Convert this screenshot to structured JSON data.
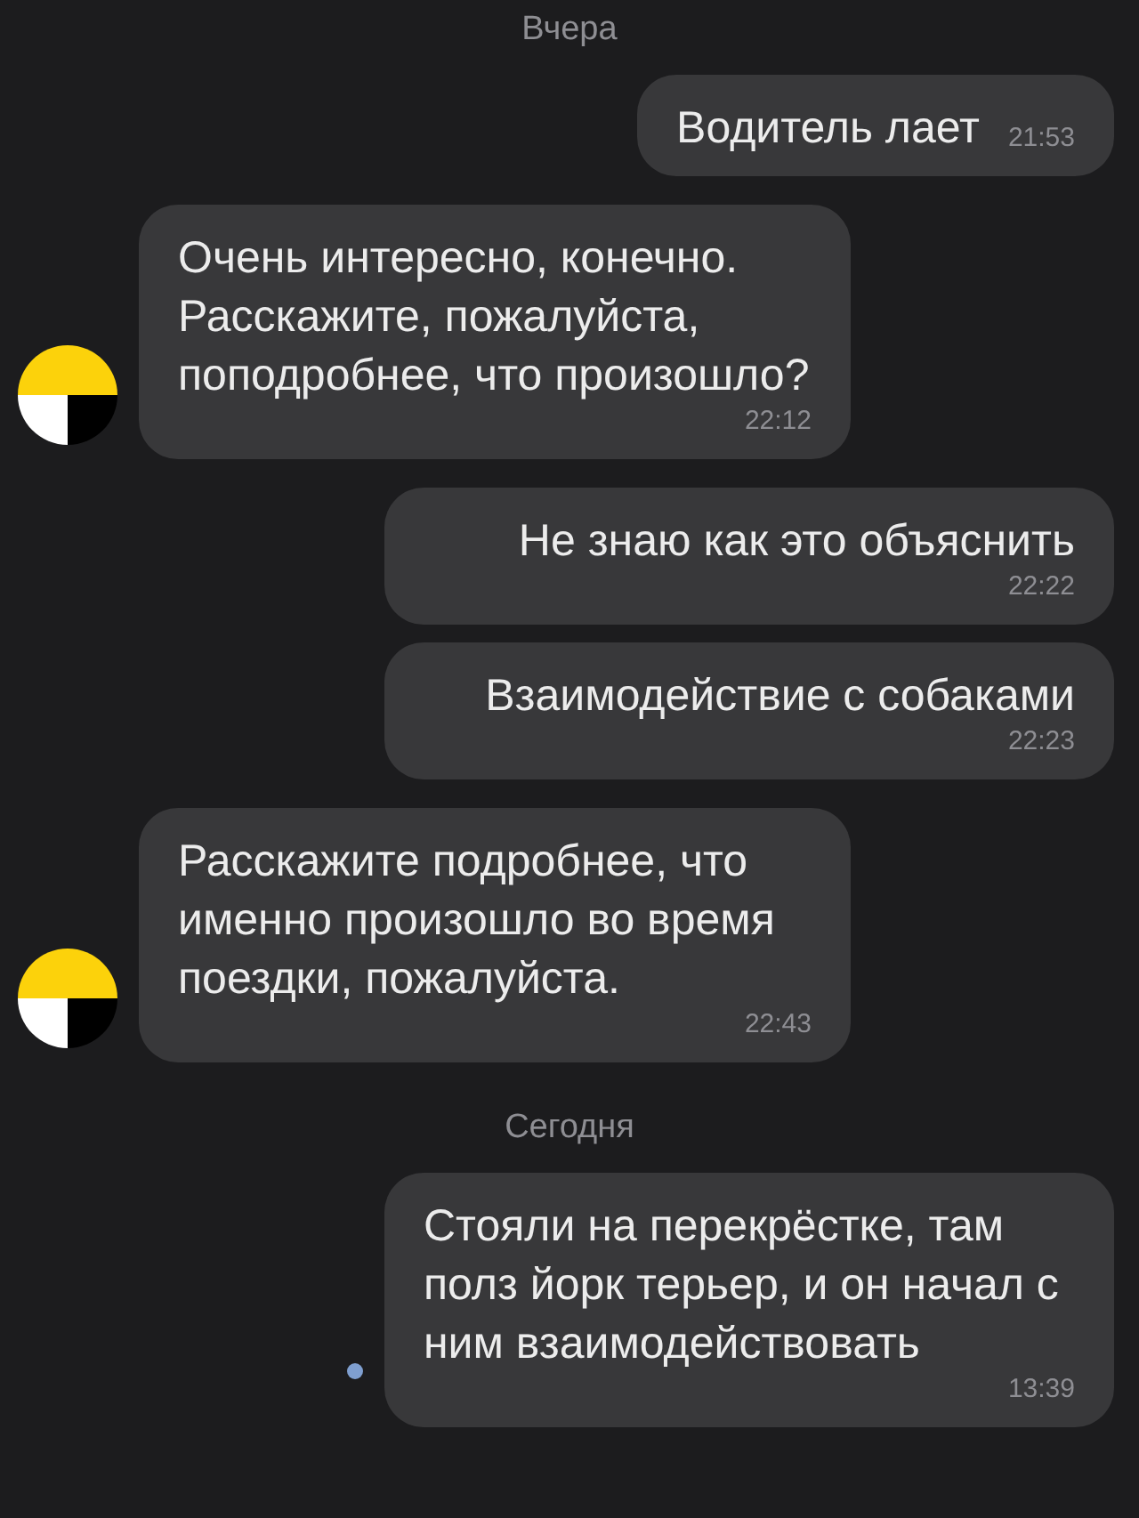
{
  "items": [
    {
      "kind": "date",
      "label": "Вчера"
    },
    {
      "kind": "message",
      "outgoing": true,
      "text": "Водитель лает",
      "time": "21:53",
      "pending": false
    },
    {
      "kind": "message",
      "outgoing": false,
      "text": "Очень интересно, конечно. Расскажите, пожалуйста, поподробнее, что произошло?",
      "time": "22:12",
      "pending": false
    },
    {
      "kind": "message",
      "outgoing": true,
      "text": "Не знаю как это объяснить",
      "time": "22:22",
      "pending": false
    },
    {
      "kind": "message",
      "outgoing": true,
      "text": "Взаимодействие с собаками",
      "time": "22:23",
      "pending": false
    },
    {
      "kind": "message",
      "outgoing": false,
      "text": "Расскажите подробнее, что именно произошло во время поездки, пожалуйста.",
      "time": "22:43",
      "pending": false
    },
    {
      "kind": "date",
      "label": "Сегодня"
    },
    {
      "kind": "message",
      "outgoing": true,
      "text": "Стояли на перекрёстке, там полз йорк терьер, и он начал с ним взаимодействовать",
      "time": "13:39",
      "pending": true
    }
  ]
}
